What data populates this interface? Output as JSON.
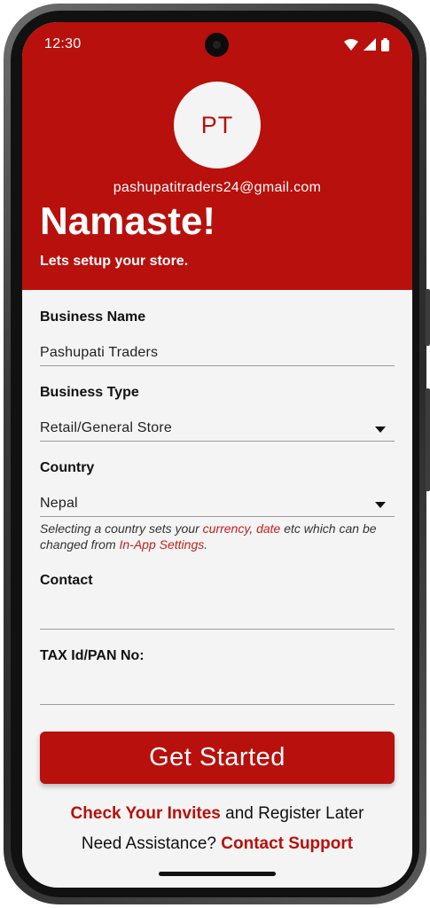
{
  "status_bar": {
    "time": "12:30",
    "icons": [
      "wifi-icon",
      "signal-icon",
      "battery-icon"
    ]
  },
  "header": {
    "avatar_initials": "PT",
    "email": "pashupatitraders24@gmail.com",
    "greeting": "Namaste!",
    "subtitle": "Lets setup your store."
  },
  "form": {
    "business_name": {
      "label": "Business Name",
      "value": "Pashupati Traders"
    },
    "business_type": {
      "label": "Business Type",
      "value": "Retail/General Store"
    },
    "country": {
      "label": "Country",
      "value": "Nepal"
    },
    "country_hint": {
      "part1": "Selecting a country sets your ",
      "currency": "currency",
      "comma": ", ",
      "date": "date",
      "part2": " etc which can be changed from ",
      "settings": "In-App Settings",
      "period": "."
    },
    "contact": {
      "label": "Contact",
      "value": ""
    },
    "tax_id": {
      "label": "TAX Id/PAN No:",
      "value": ""
    }
  },
  "actions": {
    "get_started": "Get Started",
    "check_invites": "Check Your Invites",
    "register_later": " and Register Later",
    "need_assistance": "Need Assistance? ",
    "contact_support": "Contact Support"
  },
  "colors": {
    "brand_red": "#b8100c",
    "background": "#f4f4f4"
  }
}
